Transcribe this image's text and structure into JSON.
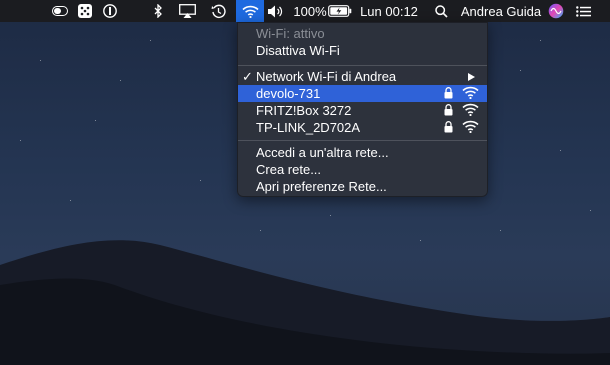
{
  "menubar": {
    "icons": [
      "switch-toggle-icon",
      "app-grid-icon",
      "info-circle-icon",
      "bluetooth-icon",
      "airplay-icon",
      "time-machine-icon",
      "wifi-icon",
      "volume-icon",
      "battery-charging-icon",
      "search-icon",
      "siri-icon",
      "list-icon"
    ],
    "battery_percent": "100%",
    "clock": "Lun 00:12",
    "user_name": "Andrea Guida"
  },
  "wifi_menu": {
    "status": "Wi-Fi: attivo",
    "toggle_label": "Disattiva Wi-Fi",
    "current_network": "Network Wi-Fi di Andrea",
    "networks": [
      {
        "name": "devolo-731",
        "locked": true,
        "highlighted": true
      },
      {
        "name": "FRITZ!Box 3272",
        "locked": true,
        "highlighted": false
      },
      {
        "name": "TP-LINK_2D702A",
        "locked": true,
        "highlighted": false
      }
    ],
    "actions": [
      "Accedi a un'altra rete...",
      "Crea rete...",
      "Apri preferenze Rete..."
    ]
  },
  "colors": {
    "menubar_bg": "#1b1c20",
    "highlight": "#2f62d8",
    "menubar_active": "#1e6ae0",
    "menu_bg": "#2e323c"
  }
}
